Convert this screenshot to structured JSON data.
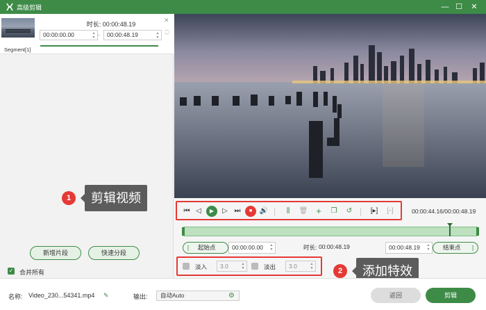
{
  "window": {
    "title": "高级剪辑",
    "minimize": "—",
    "maximize": "☐",
    "close": "✕"
  },
  "segment": {
    "duration_label": "时长:",
    "duration": "00:00:48.19",
    "start": "00:00:00.00",
    "end": "00:00:48.19",
    "dash": "-",
    "label": "Segment[1]"
  },
  "left_actions": {
    "new_segment": "新增片段",
    "quick_split": "快速分段",
    "merge_all": "合并所有"
  },
  "player": {
    "time": "00:00:44.16/00:00:48.19"
  },
  "trim": {
    "start_label": "起始点",
    "start_value": "00:00:00.00",
    "duration_label": "时长:",
    "duration_value": "00:00:48.19",
    "end_value": "00:00:48.19",
    "end_label": "结束点"
  },
  "effects": {
    "fade_in_label": "淡入",
    "fade_in_value": "3.0",
    "fade_out_label": "淡出",
    "fade_out_value": "3.0"
  },
  "callouts": [
    {
      "number": "1",
      "text": "剪辑视频"
    },
    {
      "number": "2",
      "text": "添加特效"
    }
  ],
  "bottom": {
    "name_label": "名称:",
    "file_name": "Video_230...54341.mp4",
    "output_label": "输出:",
    "output_value": "自动Auto",
    "back": "返回",
    "edit": "剪辑"
  },
  "colors": {
    "accent": "#3d8b47",
    "highlight": "#e53935"
  }
}
